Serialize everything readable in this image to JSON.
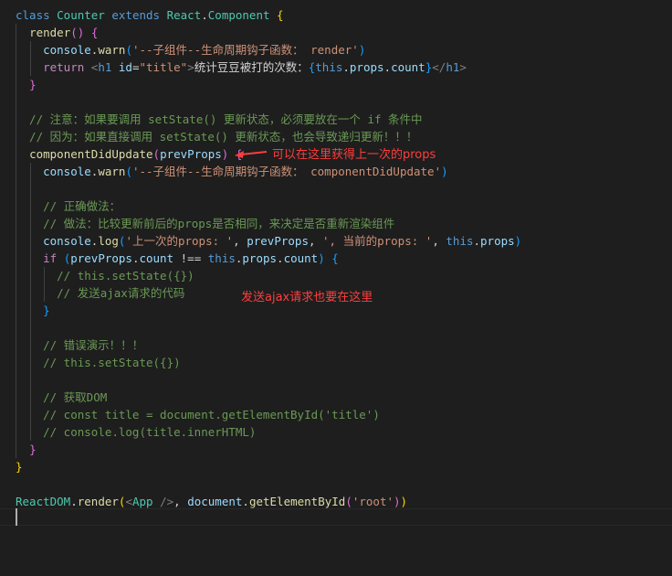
{
  "editor": {
    "language": "javascript",
    "lines": [
      [
        [
          "kw",
          "class "
        ],
        [
          "cls",
          "Counter "
        ],
        [
          "kw",
          "extends "
        ],
        [
          "cls",
          "React"
        ],
        [
          "pl",
          "."
        ],
        [
          "cls",
          "Component "
        ],
        [
          "br1",
          "{"
        ]
      ],
      [
        [
          "pl",
          "  "
        ],
        [
          "fn",
          "render"
        ],
        [
          "br2",
          "()"
        ],
        [
          "pl",
          " "
        ],
        [
          "br2",
          "{"
        ]
      ],
      [
        [
          "pl",
          "    "
        ],
        [
          "var",
          "console"
        ],
        [
          "pl",
          "."
        ],
        [
          "fn",
          "warn"
        ],
        [
          "br3",
          "("
        ],
        [
          "str",
          "'--子组件--生命周期钩子函数： render'"
        ],
        [
          "br3",
          ")"
        ]
      ],
      [
        [
          "pl",
          "    "
        ],
        [
          "ctl",
          "return "
        ],
        [
          "ang",
          "<"
        ],
        [
          "tag",
          "h1 "
        ],
        [
          "attr",
          "id"
        ],
        [
          "pl",
          "="
        ],
        [
          "str",
          "\"title\""
        ],
        [
          "ang",
          ">"
        ],
        [
          "pl",
          "统计豆豆被打的次数："
        ],
        [
          "br3",
          "{"
        ],
        [
          "kw",
          "this"
        ],
        [
          "pl",
          "."
        ],
        [
          "var",
          "props"
        ],
        [
          "pl",
          "."
        ],
        [
          "var",
          "count"
        ],
        [
          "br3",
          "}"
        ],
        [
          "ang",
          "</"
        ],
        [
          "tag",
          "h1"
        ],
        [
          "ang",
          ">"
        ]
      ],
      [
        [
          "pl",
          "  "
        ],
        [
          "br2",
          "}"
        ]
      ],
      [],
      [
        [
          "cmt",
          "  // 注意：如果要调用 setState() 更新状态，必须要放在一个 if 条件中"
        ]
      ],
      [
        [
          "cmt",
          "  // 因为：如果直接调用 setState() 更新状态，也会导致递归更新！！！"
        ]
      ],
      [
        [
          "pl",
          "  "
        ],
        [
          "fn",
          "componentDidUpdate"
        ],
        [
          "br2",
          "("
        ],
        [
          "var",
          "prevProps"
        ],
        [
          "br2",
          ")"
        ],
        [
          "pl",
          " "
        ],
        [
          "br2",
          "{"
        ]
      ],
      [
        [
          "pl",
          "    "
        ],
        [
          "var",
          "console"
        ],
        [
          "pl",
          "."
        ],
        [
          "fn",
          "warn"
        ],
        [
          "br3",
          "("
        ],
        [
          "str",
          "'--子组件--生命周期钩子函数： componentDidUpdate'"
        ],
        [
          "br3",
          ")"
        ]
      ],
      [],
      [
        [
          "cmt",
          "    // 正确做法："
        ]
      ],
      [
        [
          "cmt",
          "    // 做法：比较更新前后的props是否相同，来决定是否重新渲染组件"
        ]
      ],
      [
        [
          "pl",
          "    "
        ],
        [
          "var",
          "console"
        ],
        [
          "pl",
          "."
        ],
        [
          "fn",
          "log"
        ],
        [
          "br3",
          "("
        ],
        [
          "str",
          "'上一次的props: '"
        ],
        [
          "pl",
          ", "
        ],
        [
          "var",
          "prevProps"
        ],
        [
          "pl",
          ", "
        ],
        [
          "str",
          "', 当前的props: '"
        ],
        [
          "pl",
          ", "
        ],
        [
          "kw",
          "this"
        ],
        [
          "pl",
          "."
        ],
        [
          "var",
          "props"
        ],
        [
          "br3",
          ")"
        ]
      ],
      [
        [
          "pl",
          "    "
        ],
        [
          "ctl",
          "if "
        ],
        [
          "br3",
          "("
        ],
        [
          "var",
          "prevProps"
        ],
        [
          "pl",
          "."
        ],
        [
          "var",
          "count"
        ],
        [
          "pl",
          " !== "
        ],
        [
          "kw",
          "this"
        ],
        [
          "pl",
          "."
        ],
        [
          "var",
          "props"
        ],
        [
          "pl",
          "."
        ],
        [
          "var",
          "count"
        ],
        [
          "br3",
          ")"
        ],
        [
          "pl",
          " "
        ],
        [
          "br3",
          "{"
        ]
      ],
      [
        [
          "cmt",
          "      // this.setState({})"
        ]
      ],
      [
        [
          "cmt",
          "      // 发送ajax请求的代码"
        ]
      ],
      [
        [
          "pl",
          "    "
        ],
        [
          "br3",
          "}"
        ]
      ],
      [],
      [
        [
          "cmt",
          "    // 错误演示！！！"
        ]
      ],
      [
        [
          "cmt",
          "    // this.setState({})"
        ]
      ],
      [],
      [
        [
          "cmt",
          "    // 获取DOM"
        ]
      ],
      [
        [
          "cmt",
          "    // const title = document.getElementById('title')"
        ]
      ],
      [
        [
          "cmt",
          "    // console.log(title.innerHTML)"
        ]
      ],
      [
        [
          "pl",
          "  "
        ],
        [
          "br2",
          "}"
        ]
      ],
      [
        [
          "br1",
          "}"
        ]
      ],
      [],
      [
        [
          "cls",
          "ReactDOM"
        ],
        [
          "pl",
          "."
        ],
        [
          "fn",
          "render"
        ],
        [
          "br1",
          "("
        ],
        [
          "ang",
          "<"
        ],
        [
          "cls",
          "App "
        ],
        [
          "ang",
          "/>"
        ],
        [
          "pl",
          ", "
        ],
        [
          "var",
          "document"
        ],
        [
          "pl",
          "."
        ],
        [
          "fn",
          "getElementById"
        ],
        [
          "br2",
          "("
        ],
        [
          "str",
          "'root'"
        ],
        [
          "br2",
          ")"
        ],
        [
          "br1",
          ")"
        ]
      ],
      []
    ]
  },
  "annotations": {
    "prevprops_note": "可以在这里获得上一次的props",
    "ajax_note": "发送ajax请求也要在这里"
  },
  "colors": {
    "background": "#1e1e1e",
    "annotation": "#ff3d3d",
    "comment": "#6a9955",
    "keyword": "#569cd6",
    "string": "#ce9178"
  }
}
